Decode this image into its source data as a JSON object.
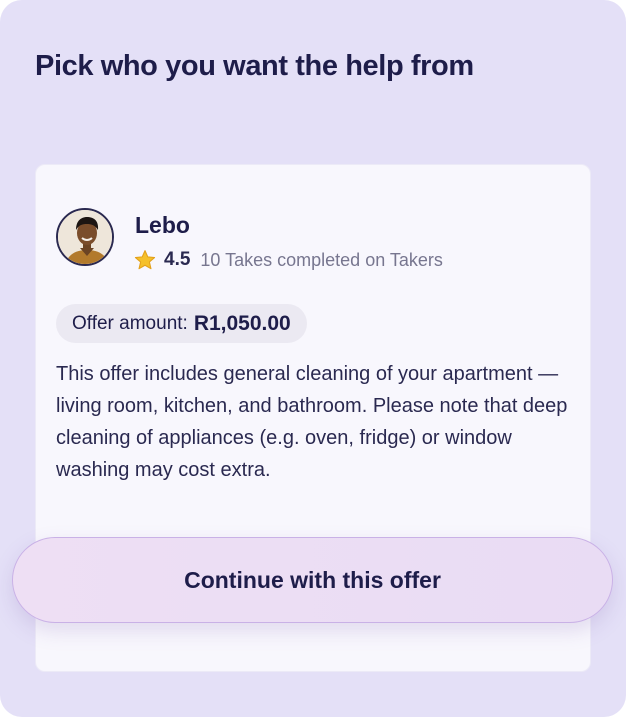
{
  "header": {
    "title": "Pick who you want the help from"
  },
  "offer": {
    "provider_name": "Lebo",
    "rating": "4.5",
    "takes_completed": "10 Takes completed on Takers",
    "amount_label": "Offer amount:",
    "amount": "R1,050.00",
    "description": "This offer includes general cleaning of your apartment — living room, kitchen, and bathroom. Please note that deep cleaning of appliances (e.g. oven, fridge) or window washing may cost extra."
  },
  "actions": {
    "continue_label": "Continue with this offer"
  },
  "icons": {
    "rating": "star-icon",
    "provider_photo": "avatar"
  },
  "colors": {
    "page_background": "#e4e0f7",
    "card_background": "#f8f7fd",
    "primary_text": "#1e1d4a",
    "button_background": "#eedff4",
    "button_border": "#c9b1e6",
    "star": "#f5c02a"
  }
}
